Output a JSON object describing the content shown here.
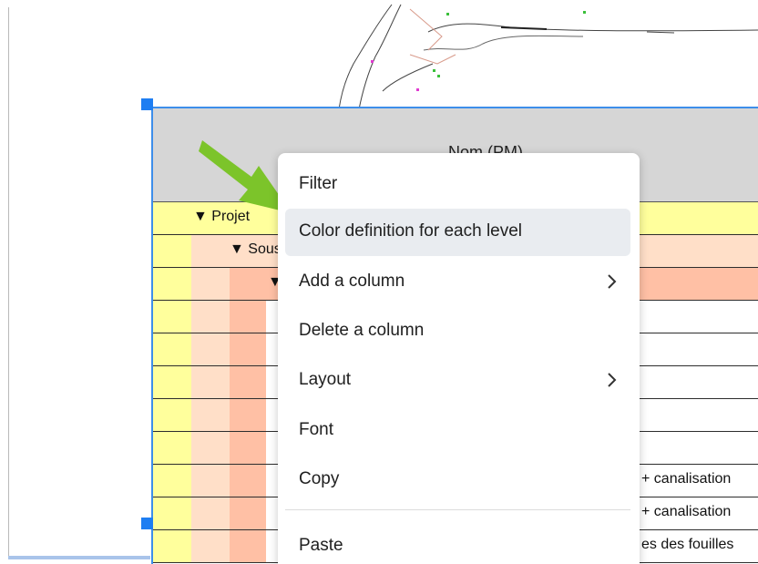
{
  "table": {
    "header_title": "Nom (PM)",
    "rows": [
      {
        "label": "▼ Projet",
        "cell": ""
      },
      {
        "label": "▼ Sous-projet",
        "cell": ""
      },
      {
        "label": "▼",
        "cell": ""
      },
      {
        "label": "",
        "cell": ""
      },
      {
        "label": "",
        "cell": ""
      },
      {
        "label": "",
        "cell": ""
      },
      {
        "label": "",
        "cell": ""
      },
      {
        "label": "",
        "cell": ""
      },
      {
        "label": "",
        "cell": "+ canalisation"
      },
      {
        "label": "",
        "cell": "+ canalisation"
      },
      {
        "label": "",
        "cell": "es des fouilles"
      }
    ]
  },
  "context_menu": {
    "items": [
      {
        "label": "Filter",
        "has_submenu": false,
        "highlighted": false
      },
      {
        "label": "Color definition for each level",
        "has_submenu": false,
        "highlighted": true
      },
      {
        "label": "Add a column",
        "has_submenu": true,
        "highlighted": false
      },
      {
        "label": "Delete a column",
        "has_submenu": false,
        "highlighted": false
      },
      {
        "label": "Layout",
        "has_submenu": true,
        "highlighted": false
      },
      {
        "label": "Font",
        "has_submenu": false,
        "highlighted": false
      },
      {
        "label": "Copy",
        "has_submenu": false,
        "highlighted": false
      },
      {
        "label": "Paste",
        "has_submenu": false,
        "highlighted": false
      }
    ]
  },
  "colors": {
    "selection_blue": "#3d8eea",
    "level1": "#ffff9c",
    "level2": "#ffdfc8",
    "level3": "#ffc0a5",
    "header_gray": "#d6d6d6",
    "pointer_arrow": "#7cc42a",
    "menu_highlight": "#e9ecf0"
  },
  "icons": {
    "pointer": "green-arrow-icon",
    "submenu": "chevron-right-icon"
  }
}
